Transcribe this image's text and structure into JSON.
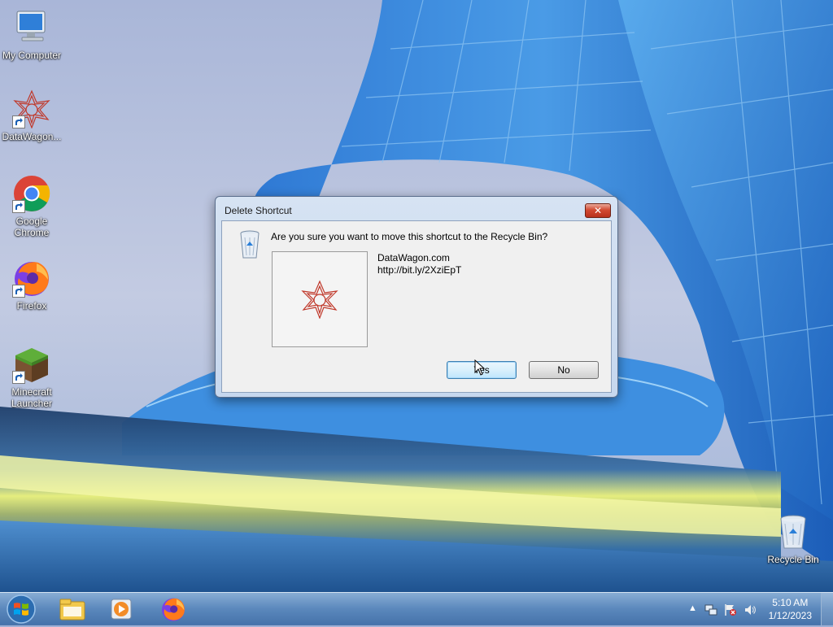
{
  "desktop": {
    "icons": [
      {
        "label": "My Computer"
      },
      {
        "label": "DataWagon..."
      },
      {
        "label": "Google Chrome"
      },
      {
        "label": "Firefox"
      },
      {
        "label": "Minecraft Launcher"
      },
      {
        "label": "Recycle Bin"
      }
    ]
  },
  "dialog": {
    "title": "Delete Shortcut",
    "close_label": "✕",
    "question": "Are you sure you want to move this shortcut to the Recycle Bin?",
    "item_name": "DataWagon.com",
    "item_url": "http://bit.ly/2XziEpT",
    "yes_label": "Yes",
    "no_label": "No"
  },
  "taskbar": {
    "items": [
      {
        "icon": "file-explorer-icon"
      },
      {
        "icon": "media-player-icon"
      },
      {
        "icon": "firefox-icon"
      }
    ],
    "tray": {
      "show_hidden": "▲",
      "time": "5:10 AM",
      "date": "1/12/2023"
    }
  }
}
